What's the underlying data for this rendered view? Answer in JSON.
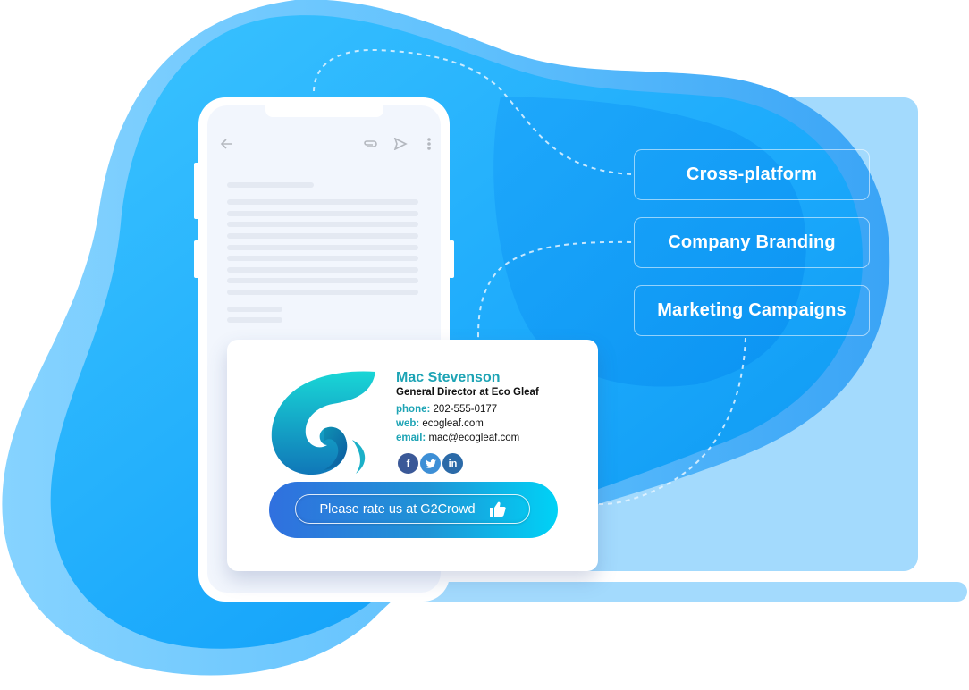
{
  "illustration": {
    "colors": {
      "blob_light": "#7dcffd",
      "blob_main": "#2bb5fd",
      "blob_deep": "#1596f2",
      "laptop": "#a3dafd",
      "screen_bg": "#f2f6fd",
      "skeleton": "#e4e9f2",
      "accent_teal": "#1ea4b5"
    }
  },
  "phone": {
    "toolbar_icons": [
      "arrow-left-icon",
      "paperclip-icon",
      "send-icon",
      "more-vertical-icon"
    ]
  },
  "signature": {
    "name": "Mac Stevenson",
    "title": "General Director at Eco Gleaf",
    "phone_label": "phone:",
    "phone_value": "202-555-0177",
    "web_label": "web:",
    "web_value": "ecogleaf.com",
    "email_label": "email:",
    "email_value": "mac@ecogleaf.com",
    "social": [
      {
        "name": "facebook",
        "glyph": "f",
        "color": "#3b5998"
      },
      {
        "name": "twitter",
        "glyph": "t",
        "color": "#3d8fd6"
      },
      {
        "name": "linkedin",
        "glyph": "in",
        "color": "#2b6aa8"
      }
    ],
    "cta_label": "Please rate us at G2Crowd",
    "cta_icon": "thumbs-up-icon"
  },
  "features": [
    {
      "label": "Cross-platform"
    },
    {
      "label": "Company Branding"
    },
    {
      "label": "Marketing Campaigns"
    }
  ]
}
